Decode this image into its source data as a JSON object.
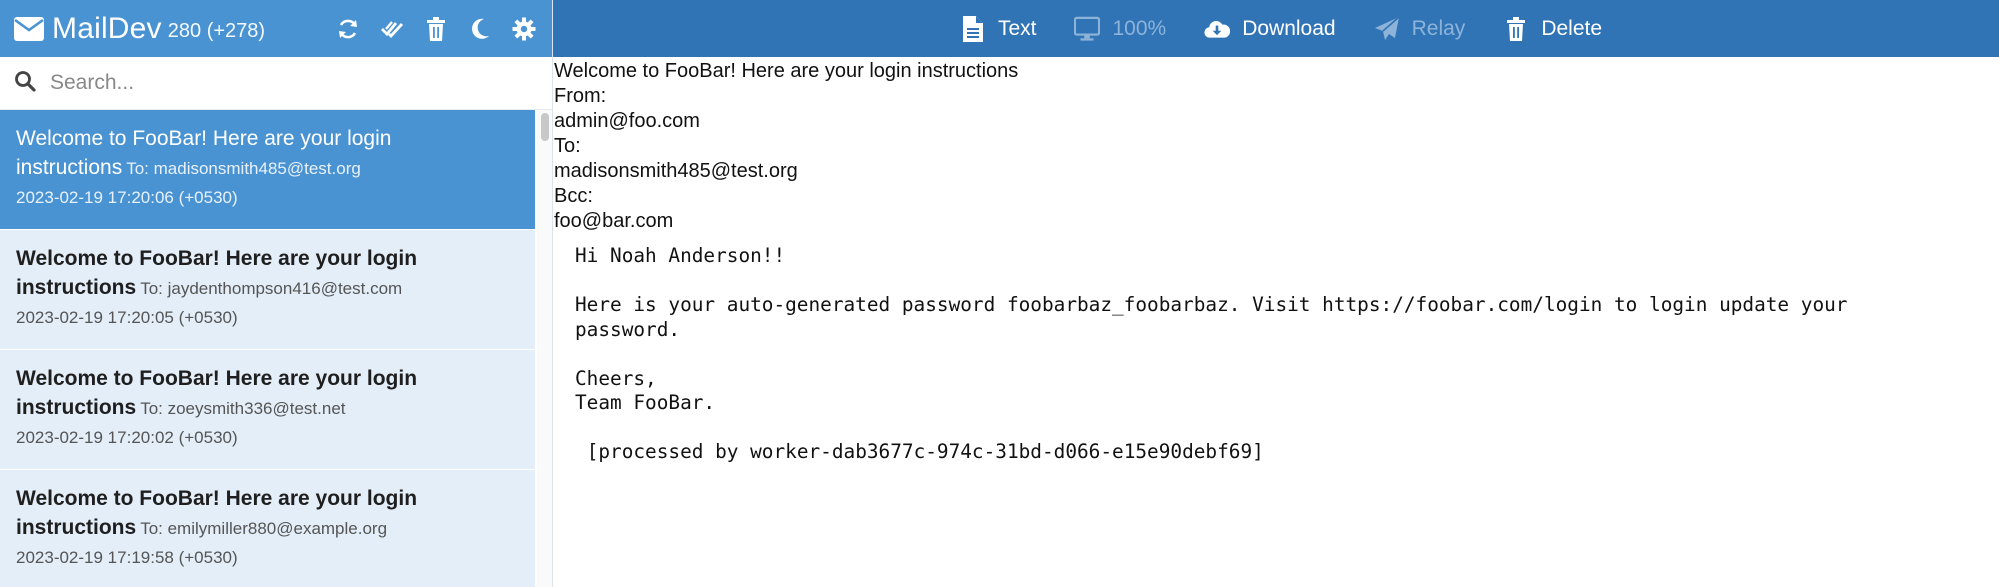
{
  "app": {
    "name": "MailDev",
    "count": "280 (+278)"
  },
  "toolbar_icons": [
    "refresh-icon",
    "mark-all-read-icon",
    "trash-icon",
    "moon-icon",
    "gear-icon"
  ],
  "search": {
    "placeholder": "Search..."
  },
  "emails": [
    {
      "subject": "Welcome to FooBar! Here are your login instructions",
      "to": "To: madisonsmith485@test.org",
      "date": "2023-02-19 17:20:06 (+0530)",
      "active": true
    },
    {
      "subject": "Welcome to FooBar! Here are your login instructions",
      "to": "To: jaydenthompson416@test.com",
      "date": "2023-02-19 17:20:05 (+0530)",
      "active": false
    },
    {
      "subject": "Welcome to FooBar! Here are your login instructions",
      "to": "To: zoeysmith336@test.net",
      "date": "2023-02-19 17:20:02 (+0530)",
      "active": false
    },
    {
      "subject": "Welcome to FooBar! Here are your login instructions",
      "to": "To: emilymiller880@example.org",
      "date": "2023-02-19 17:19:58 (+0530)",
      "active": false
    }
  ],
  "actions": {
    "text": "Text",
    "zoom": "100%",
    "download": "Download",
    "relay": "Relay",
    "delete": "Delete"
  },
  "message": {
    "subject": "Welcome to FooBar! Here are your login instructions",
    "from_label": "From:",
    "from": "admin@foo.com",
    "to_label": "To:",
    "to": "madisonsmith485@test.org",
    "bcc_label": "Bcc:",
    "bcc": "foo@bar.com",
    "body": "Hi Noah Anderson!!\n\nHere is your auto-generated password foobarbaz_foobarbaz. Visit https://foobar.com/login to login update your\npassword.\n\nCheers,\nTeam FooBar.\n\n [processed by worker-dab3677c-974c-31bd-d066-e15e90debf69]"
  },
  "colors": {
    "sidebar_header": "#4a93d3",
    "main_header": "#3074b6",
    "list_item_bg": "#e3eef8",
    "active_item_bg": "#4a93d3"
  }
}
